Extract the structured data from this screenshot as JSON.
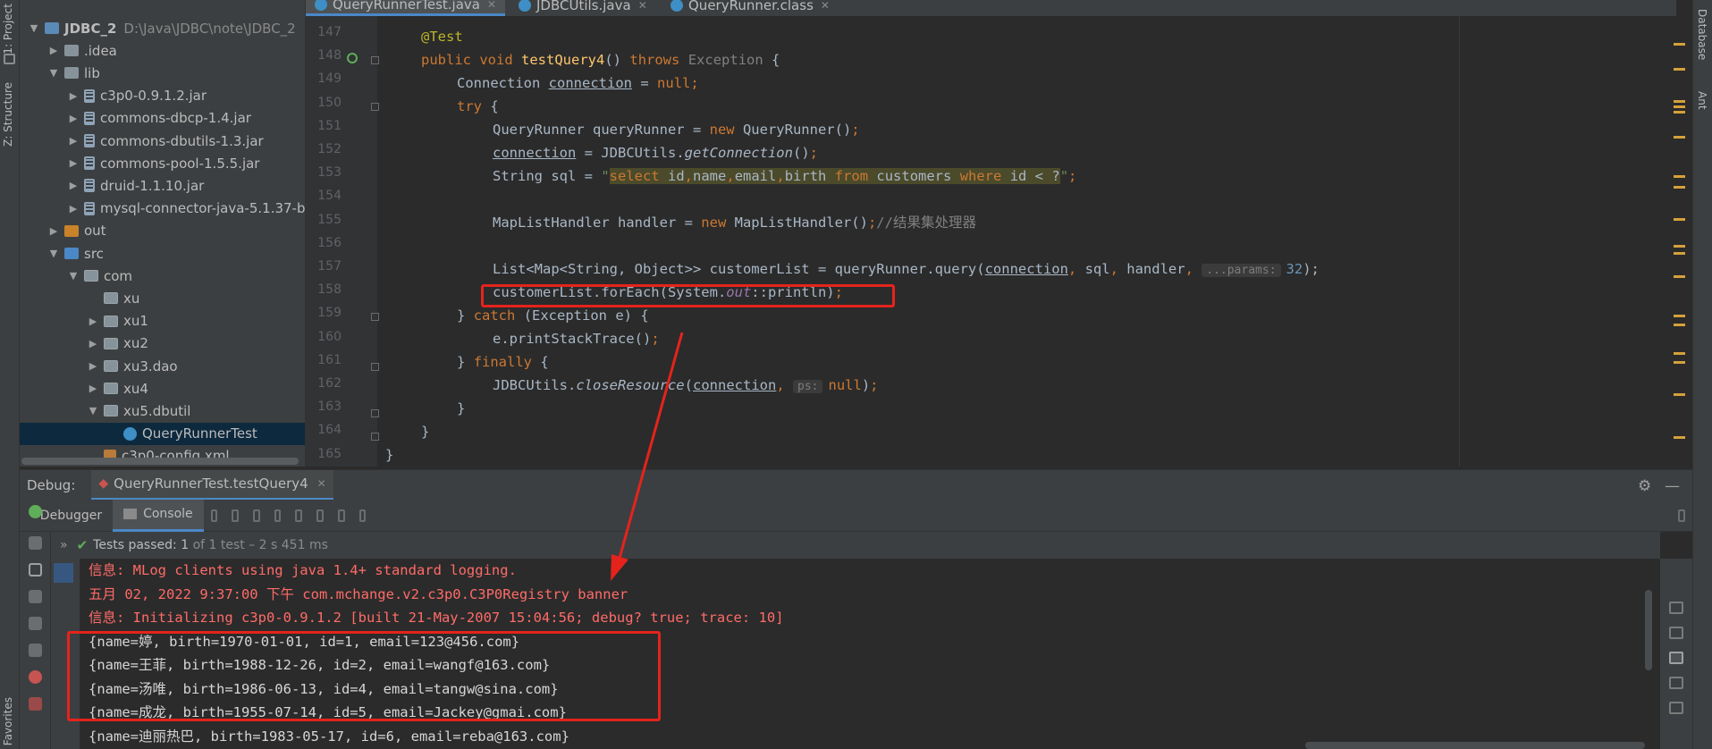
{
  "left_strip": {
    "project_tab": "1: Project",
    "structure_tab": "Z: Structure",
    "favorites_tab": "Favorites"
  },
  "right_strip": {
    "database_tab": "Database",
    "ant_tab": "Ant"
  },
  "project": {
    "title": "Project",
    "tree": [
      {
        "label": "JDBC_2",
        "extra": "D:\\Java\\JDBC\\note\\JDBC_2",
        "icon": "project-folder-icon",
        "depth": 0,
        "expanded": true
      },
      {
        "label": ".idea",
        "icon": "folder-icon",
        "depth": 1,
        "expanded": false
      },
      {
        "label": "lib",
        "icon": "folder-icon",
        "depth": 1,
        "expanded": true
      },
      {
        "label": "c3p0-0.9.1.2.jar",
        "icon": "jar-icon",
        "depth": 2,
        "expanded": false
      },
      {
        "label": "commons-dbcp-1.4.jar",
        "icon": "jar-icon",
        "depth": 2,
        "expanded": false
      },
      {
        "label": "commons-dbutils-1.3.jar",
        "icon": "jar-icon",
        "depth": 2,
        "expanded": false
      },
      {
        "label": "commons-pool-1.5.5.jar",
        "icon": "jar-icon",
        "depth": 2,
        "expanded": false
      },
      {
        "label": "druid-1.1.10.jar",
        "icon": "jar-icon",
        "depth": 2,
        "expanded": false
      },
      {
        "label": "mysql-connector-java-5.1.37-b",
        "icon": "jar-icon",
        "depth": 2,
        "expanded": false
      },
      {
        "label": "out",
        "icon": "folder-orange-icon",
        "depth": 1,
        "expanded": false
      },
      {
        "label": "src",
        "icon": "folder-blue-icon",
        "depth": 1,
        "expanded": true
      },
      {
        "label": "com",
        "icon": "package-icon",
        "depth": 2,
        "expanded": true
      },
      {
        "label": "xu",
        "icon": "package-icon",
        "depth": 3,
        "expanded": null
      },
      {
        "label": "xu1",
        "icon": "package-icon",
        "depth": 3,
        "expanded": false
      },
      {
        "label": "xu2",
        "icon": "package-icon",
        "depth": 3,
        "expanded": false
      },
      {
        "label": "xu3.dao",
        "icon": "package-icon",
        "depth": 3,
        "expanded": false
      },
      {
        "label": "xu4",
        "icon": "package-icon",
        "depth": 3,
        "expanded": false
      },
      {
        "label": "xu5.dbutil",
        "icon": "package-icon",
        "depth": 3,
        "expanded": true
      },
      {
        "label": "QueryRunnerTest",
        "icon": "class-icon",
        "depth": 4,
        "expanded": null,
        "selected": true
      },
      {
        "label": "c3p0-config.xml",
        "icon": "xml-icon",
        "depth": 3,
        "expanded": null
      }
    ]
  },
  "editor": {
    "tabs": [
      {
        "label": "QueryRunnerTest.java",
        "active": true
      },
      {
        "label": "JDBCUtils.java",
        "active": false
      },
      {
        "label": "QueryRunner.class",
        "active": false
      }
    ],
    "line_numbers": [
      "147",
      "148",
      "149",
      "150",
      "151",
      "152",
      "153",
      "154",
      "155",
      "156",
      "157",
      "158",
      "159",
      "160",
      "161",
      "162",
      "163",
      "164",
      "165"
    ],
    "code": {
      "l147_annotation": "@Test",
      "l148_public": "public",
      "l148_void": "void",
      "l148_method": "testQuery4",
      "l148_parens": "()",
      "l148_throws": "throws",
      "l148_exception": "Exception",
      "l148_brace": "{",
      "l149_type": "Connection",
      "l149_var": "connection",
      "l149_eq": "=",
      "l149_null": "null",
      "l149_semi": ";",
      "l150_try": "try",
      "l150_brace": "{",
      "l151_decl": "QueryRunner queryRunner = ",
      "l151_new": "new",
      "l151_rest": " QueryRunner()",
      "l151_semi": ";",
      "l152_var": "connection",
      "l152_mid": " = JDBCUtils.",
      "l152_method": "getConnection",
      "l152_end": "()",
      "l152_semi": ";",
      "l153_decl": "String sql = ",
      "l153_q1": "\"",
      "l153_sql1": "select",
      "l153_sql2": " id",
      "l153_sql3": ",",
      "l153_sql4": "name",
      "l153_sql5": ",",
      "l153_sql6": "email",
      "l153_sql7": ",",
      "l153_sql8": "birth ",
      "l153_sql9": "from",
      "l153_sql10": " customers ",
      "l153_sql11": "where",
      "l153_sql12": " id < ?",
      "l153_q2": "\"",
      "l153_semi": ";",
      "l155_decl": "MapListHandler handler = ",
      "l155_new": "new",
      "l155_rest": " MapListHandler()",
      "l155_semi": ";",
      "l155_comment": "//结果集处理器",
      "l157_decl": "List<Map<String, Object>> customerList = queryRunner.query(",
      "l157_conn": "connection",
      "l157_comma1": ", ",
      "l157_sql": "sql",
      "l157_comma2": ", ",
      "l157_handler": "handler",
      "l157_comma3": ", ",
      "l157_hint": "...params:",
      "l157_num": "32",
      "l157_end": ");",
      "l158_a": "customerList.forEach(System.",
      "l158_out": "out",
      "l158_b": "::println)",
      "l158_semi": ";",
      "l159_brace": "}",
      "l159_catch": "catch",
      "l159_rest": " (Exception e) {",
      "l160_call": "e.printStackTrace()",
      "l160_semi": ";",
      "l161_brace": "}",
      "l161_finally": "finally",
      "l161_open": " {",
      "l162_a": "JDBCUtils.",
      "l162_method": "closeResource",
      "l162_b": "(",
      "l162_conn": "connection",
      "l162_comma": ", ",
      "l162_hint": "ps:",
      "l162_null": "null",
      "l162_end": ")",
      "l162_semi": ";",
      "l163": "}",
      "l164": "}",
      "l165": "}"
    }
  },
  "debug": {
    "title": "Debug:",
    "session": "QueryRunnerTest.testQuery4",
    "tabs": [
      {
        "label": "Debugger",
        "active": false
      },
      {
        "label": "Console",
        "active": true
      }
    ],
    "tests": {
      "status": "Tests passed:",
      "passed": "1",
      "of_total": "of 1 test",
      "duration": "– 2 s 451 ms"
    },
    "console_lines": [
      {
        "text": "信息: MLog clients using java 1.4+ standard logging.",
        "kind": "red"
      },
      {
        "text": "五月 02, 2022 9:37:00 下午 com.mchange.v2.c3p0.C3P0Registry banner",
        "kind": "red"
      },
      {
        "text": "信息: Initializing c3p0-0.9.1.2 [built 21-May-2007 15:04:56; debug? true; trace: 10]",
        "kind": "red"
      },
      {
        "text": "{name=婷, birth=1970-01-01, id=1, email=123@456.com}",
        "kind": "out"
      },
      {
        "text": "{name=王菲, birth=1988-12-26, id=2, email=wangf@163.com}",
        "kind": "out"
      },
      {
        "text": "{name=汤唯, birth=1986-06-13, id=4, email=tangw@sina.com}",
        "kind": "out"
      },
      {
        "text": "{name=成龙, birth=1955-07-14, id=5, email=Jackey@gmai.com}",
        "kind": "out"
      },
      {
        "text": "{name=迪丽热巴, birth=1983-05-17, id=6, email=reba@163.com}",
        "kind": "out"
      }
    ]
  },
  "colors": {
    "annotation": "#e5231c",
    "keyword": "#cc7832",
    "string": "#6a8759",
    "console_error": "#ff6b68"
  }
}
